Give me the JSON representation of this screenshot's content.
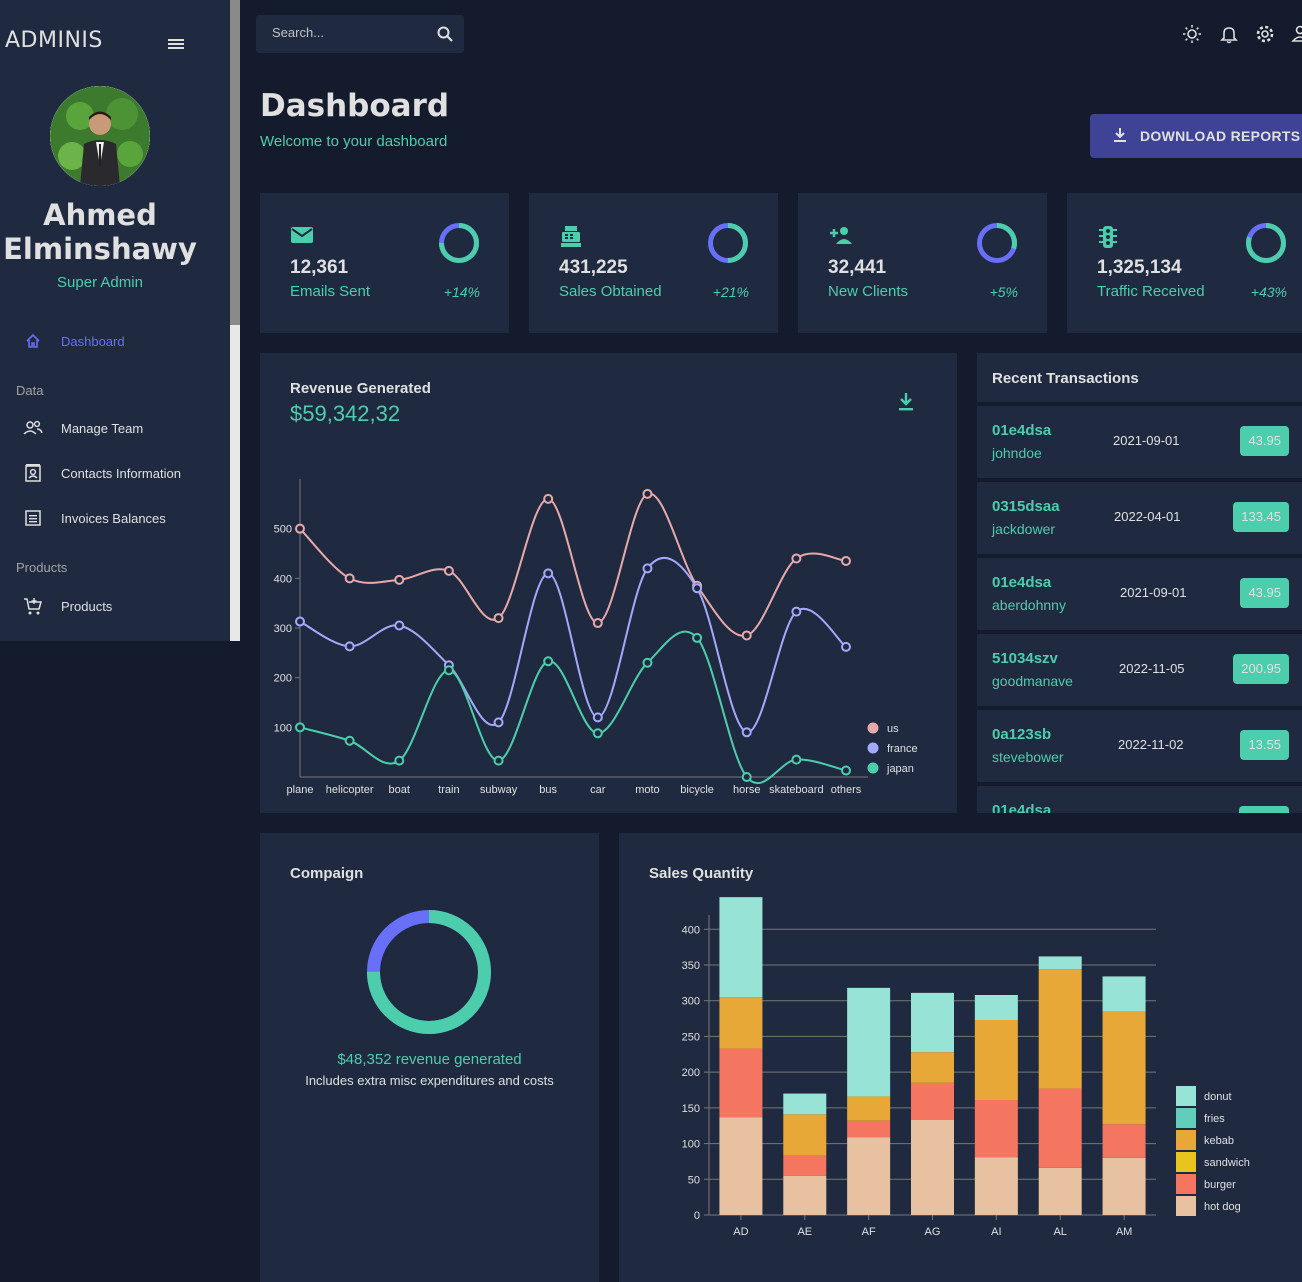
{
  "app": {
    "brand": "ADMINIS"
  },
  "user": {
    "name_line1": "Ahmed",
    "name_line2": "Elminshawy",
    "role": "Super Admin"
  },
  "sidebar": {
    "items": [
      {
        "label": "Dashboard",
        "icon": "home-icon",
        "active": true
      },
      {
        "label": "Manage Team",
        "icon": "people-icon"
      },
      {
        "label": "Contacts Information",
        "icon": "contacts-icon"
      },
      {
        "label": "Invoices Balances",
        "icon": "receipt-icon"
      },
      {
        "label": "Products",
        "icon": "cart-icon"
      }
    ],
    "sections": [
      "Data",
      "Products"
    ]
  },
  "search": {
    "placeholder": "Search..."
  },
  "header": {
    "title": "Dashboard",
    "subtitle": "Welcome to your dashboard",
    "download_label": "DOWNLOAD REPORTS"
  },
  "stats": [
    {
      "value": "12,361",
      "label": "Emails Sent",
      "increase": "+14%",
      "progress": 0.75,
      "icon": "email-icon"
    },
    {
      "value": "431,225",
      "label": "Sales Obtained",
      "increase": "+21%",
      "progress": 0.5,
      "icon": "point-of-sale-icon"
    },
    {
      "value": "32,441",
      "label": "New Clients",
      "increase": "+5%",
      "progress": 0.3,
      "icon": "person-add-icon"
    },
    {
      "value": "1,325,134",
      "label": "Traffic Received",
      "increase": "+43%",
      "progress": 0.8,
      "icon": "traffic-icon"
    }
  ],
  "revenue": {
    "title": "Revenue Generated",
    "amount": "$59,342,32"
  },
  "transactions": {
    "title": "Recent Transactions",
    "rows": [
      {
        "id": "01e4dsa",
        "user": "johndoe",
        "date": "2021-09-01",
        "cost": "43.95"
      },
      {
        "id": "0315dsaa",
        "user": "jackdower",
        "date": "2022-04-01",
        "cost": "133.45"
      },
      {
        "id": "01e4dsa",
        "user": "aberdohnny",
        "date": "2021-09-01",
        "cost": "43.95"
      },
      {
        "id": "51034szv",
        "user": "goodmanave",
        "date": "2022-11-05",
        "cost": "200.95"
      },
      {
        "id": "0a123sb",
        "user": "stevebower",
        "date": "2022-11-02",
        "cost": "13.55"
      },
      {
        "id": "01e4dsa",
        "user": "",
        "date": "",
        "cost": ""
      }
    ]
  },
  "campaign": {
    "title": "Compaign",
    "revenue_text": "$48,352 revenue generated",
    "note": "Includes extra misc expenditures and costs",
    "progress": 0.75
  },
  "sales": {
    "title": "Sales Quantity"
  },
  "colors": {
    "accent": "#4cceac",
    "blue": "#6870fa",
    "primary": "#1f2a40",
    "bg": "#141b2d",
    "button": "#3e4396"
  },
  "chart_data": [
    {
      "type": "line",
      "x": [
        "plane",
        "helicopter",
        "boat",
        "train",
        "subway",
        "bus",
        "car",
        "moto",
        "bicycle",
        "horse",
        "skateboard",
        "others"
      ],
      "ylim": [
        0,
        600
      ],
      "yticks": [
        100,
        200,
        300,
        400,
        500
      ],
      "legend": "bottom-right",
      "series": [
        {
          "name": "us",
          "color": "#e8a9a9",
          "values": [
            500,
            400,
            397,
            415,
            320,
            560,
            310,
            570,
            385,
            285,
            440,
            435
          ]
        },
        {
          "name": "france",
          "color": "#a4a9fc",
          "values": [
            313,
            263,
            305,
            225,
            110,
            410,
            120,
            420,
            380,
            90,
            333,
            262
          ]
        },
        {
          "name": "japan",
          "color": "#4cceac",
          "values": [
            100,
            73,
            33,
            215,
            33,
            233,
            88,
            230,
            280,
            0,
            35,
            13
          ]
        }
      ]
    },
    {
      "type": "bar",
      "stacked": true,
      "categories": [
        "AD",
        "AE",
        "AF",
        "AG",
        "AI",
        "AL",
        "AM"
      ],
      "ylim": [
        0,
        420
      ],
      "yticks": [
        0,
        50,
        100,
        150,
        200,
        250,
        300,
        350,
        400
      ],
      "legend": "right",
      "series": [
        {
          "name": "hot dog",
          "color": "#e8c1a0",
          "values": [
            137,
            55,
            109,
            133,
            81,
            66,
            80
          ]
        },
        {
          "name": "burger",
          "color": "#f47560",
          "values": [
            96,
            28,
            23,
            52,
            80,
            111,
            47
          ]
        },
        {
          "name": "sandwich",
          "color": "#e8c41e",
          "values": [
            0,
            0,
            0,
            0,
            0,
            0,
            0
          ]
        },
        {
          "name": "kebab",
          "color": "#e8a838",
          "values": [
            72,
            58,
            34,
            43,
            112,
            167,
            158
          ]
        },
        {
          "name": "fries",
          "color": "#61cdbb",
          "values": [
            0,
            0,
            0,
            0,
            0,
            0,
            0
          ]
        },
        {
          "name": "donut",
          "color": "#97e3d5",
          "values": [
            140,
            29,
            152,
            83,
            35,
            18,
            49
          ]
        }
      ]
    }
  ]
}
